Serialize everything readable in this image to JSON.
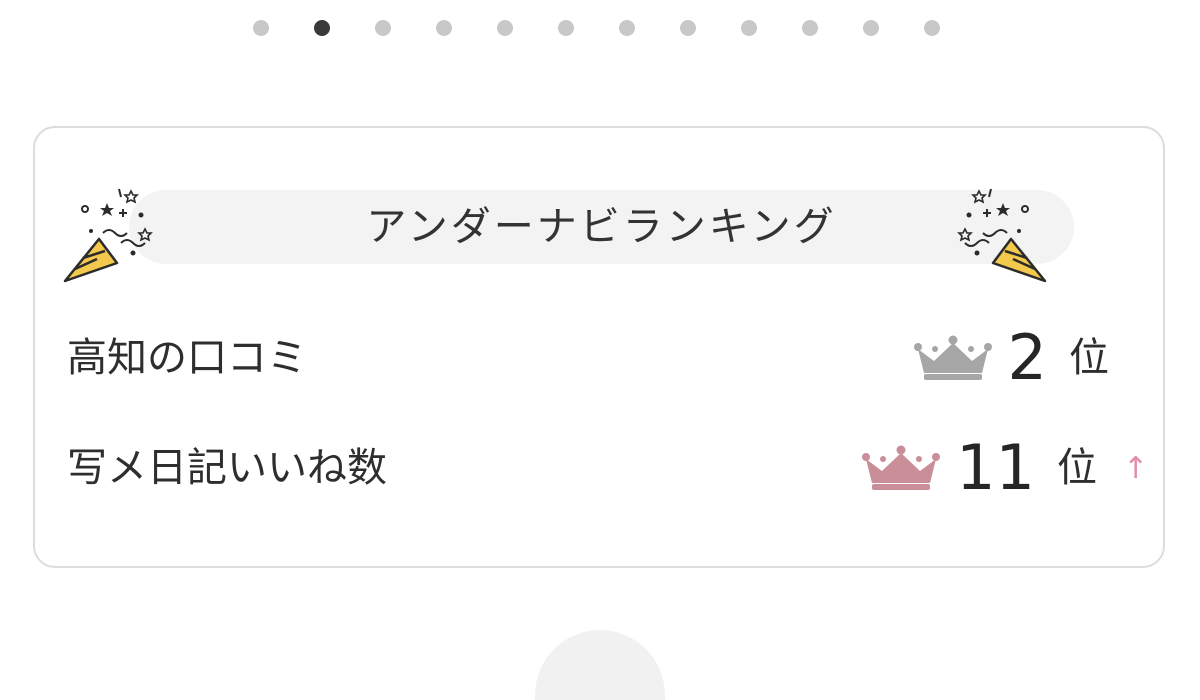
{
  "pagination": {
    "total": 12,
    "active_index": 1
  },
  "ranking": {
    "title": "アンダーナビランキング",
    "items": [
      {
        "label": "高知の口コミ",
        "rank": "2",
        "suffix": "位",
        "crown": "silver-crown-icon",
        "crown_color": "#a6a6a6",
        "trend": ""
      },
      {
        "label": "写メ日記いいね数",
        "rank": "11",
        "suffix": "位",
        "crown": "pink-crown-icon",
        "crown_color": "#c98e97",
        "trend": "↑"
      }
    ]
  },
  "colors": {
    "dot_active": "#3a3a3a",
    "dot_inactive": "#c8c8c8",
    "trend_up": "#e58da6"
  },
  "icons": {
    "banner_left": "party-popper-icon",
    "banner_right": "party-popper-icon"
  }
}
